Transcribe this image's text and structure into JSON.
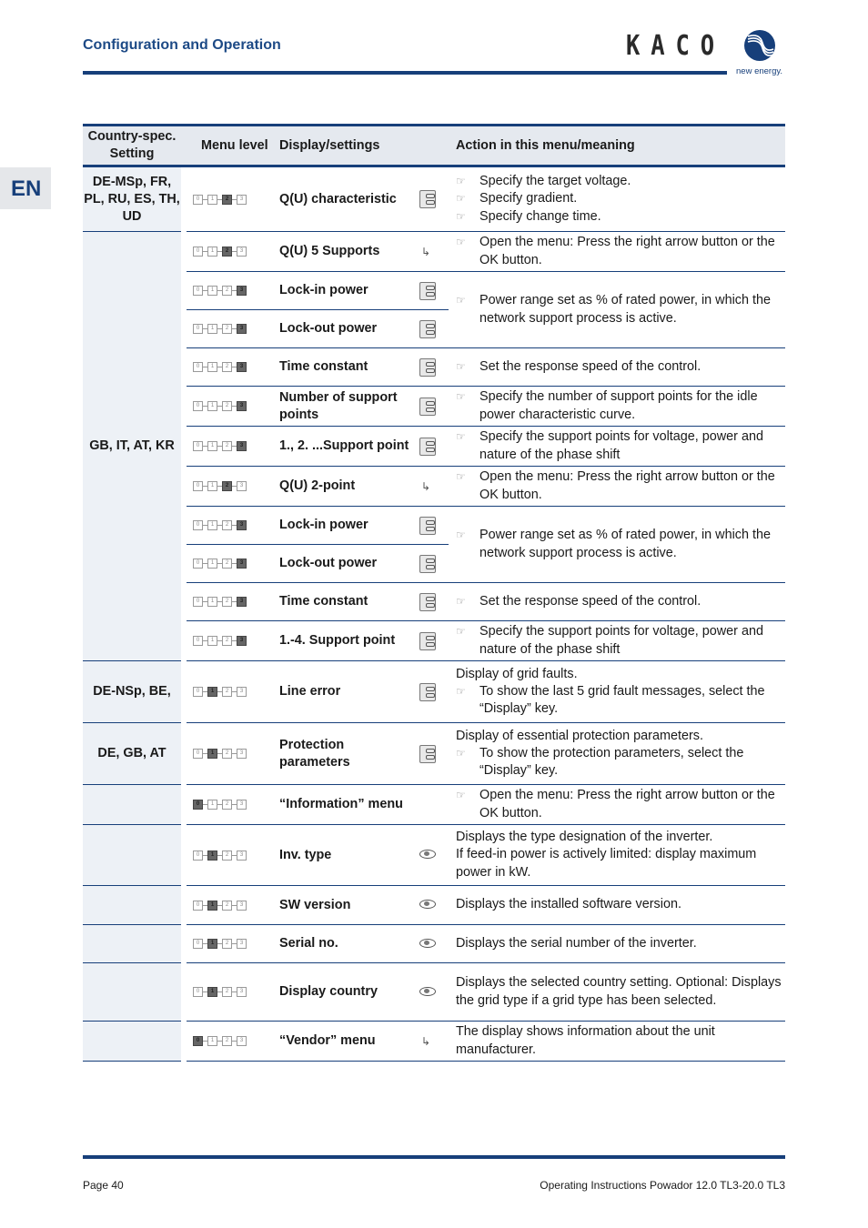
{
  "header": {
    "title": "Configuration and Operation",
    "logo_text": "KACO",
    "logo_tagline": "new energy."
  },
  "language_tab": "EN",
  "table": {
    "headers": [
      "Country-spec. Setting",
      "Menu level",
      "Display/settings",
      "Action in this menu/meaning"
    ],
    "rows": [
      {
        "country": "DE-MSp, FR, PL, RU, ES, TH, UD",
        "level": 2,
        "label": "Q(U) characteristic",
        "icon": "settings-icon",
        "action": {
          "text": "",
          "bullets": [
            "Specify the target voltage.",
            "Specify gradient.",
            "Specify change time."
          ]
        }
      },
      {
        "country": "GB, IT, AT, KR",
        "level": 2,
        "label": "Q(U) 5 Supports",
        "icon": "submenu-arrow-icon",
        "action": {
          "text": "",
          "bullets": [
            "Open the menu: Press the right arrow button or the OK button."
          ]
        }
      },
      {
        "level": 3,
        "label": "Lock-in power",
        "icon": "settings-icon",
        "action": {
          "text": "",
          "bullets": [
            "Power range set as % of rated power, in which the network support process is active."
          ]
        }
      },
      {
        "level": 3,
        "label": "Lock-out power",
        "icon": "settings-icon"
      },
      {
        "level": 3,
        "label": "Time constant",
        "icon": "settings-icon",
        "action": {
          "text": "",
          "bullets": [
            "Set the response speed of the control."
          ]
        }
      },
      {
        "level": 3,
        "label": "Number of support points",
        "icon": "settings-icon",
        "action": {
          "text": "",
          "bullets": [
            "Specify the number of support points for the idle power characteristic curve."
          ]
        }
      },
      {
        "level": 3,
        "label": "1., 2. ...Support point",
        "icon": "settings-icon",
        "action": {
          "text": "",
          "bullets": [
            "Specify the support points for voltage, power and nature of the phase shift"
          ]
        }
      },
      {
        "level": 2,
        "label": "Q(U) 2-point",
        "icon": "submenu-arrow-icon",
        "action": {
          "text": "",
          "bullets": [
            "Open the menu: Press the right arrow button or the OK button."
          ]
        }
      },
      {
        "level": 3,
        "label": "Lock-in power",
        "icon": "settings-icon",
        "action": {
          "text": "",
          "bullets": [
            "Power range set as % of rated power, in which the network support process is active."
          ]
        }
      },
      {
        "level": 3,
        "label": "Lock-out power",
        "icon": "settings-icon"
      },
      {
        "level": 3,
        "label": "Time constant",
        "icon": "settings-icon",
        "action": {
          "text": "",
          "bullets": [
            "Set the response speed of the control."
          ]
        }
      },
      {
        "level": 3,
        "label": "1.-4. Support point",
        "icon": "settings-icon",
        "action": {
          "text": "",
          "bullets": [
            "Specify the support points for voltage, power and nature of the phase shift"
          ]
        }
      },
      {
        "country": "DE-NSp, BE,",
        "level": 1,
        "label": "Line error",
        "icon": "settings-icon",
        "action": {
          "text": "Display of grid faults.",
          "bullets": [
            "To show the last 5 grid fault messages, select the “Display” key."
          ]
        }
      },
      {
        "country": "DE, GB, AT",
        "level": 1,
        "label": "Protection parameters",
        "icon": "settings-icon",
        "action": {
          "text": "Display of essential protection parameters.",
          "bullets": [
            "To show the protection parameters, select the “Display” key."
          ]
        }
      },
      {
        "country": "",
        "level": 0,
        "label": "“Information” menu",
        "icon": "",
        "action": {
          "text": "",
          "bullets": [
            "Open the menu: Press the right arrow button or the OK button."
          ]
        }
      },
      {
        "country": "",
        "level": 1,
        "label": "Inv. type",
        "icon": "eye-icon",
        "action": {
          "text": "Displays the type designation of the inverter.",
          "text2": "If feed-in power is actively limited: display maximum power in kW.",
          "bullets": []
        }
      },
      {
        "country": "",
        "level": 1,
        "label": "SW version",
        "icon": "eye-icon",
        "action": {
          "text": "Displays the installed software version.",
          "bullets": []
        }
      },
      {
        "country": "",
        "level": 1,
        "label": "Serial no.",
        "icon": "eye-icon",
        "action": {
          "text": "Displays the serial number of the inverter.",
          "bullets": []
        }
      },
      {
        "country": "",
        "level": 1,
        "label": "Display country",
        "icon": "eye-icon",
        "action": {
          "text": "Displays the selected country setting. Optional: Displays the grid type if a grid type has been selected.",
          "bullets": []
        }
      },
      {
        "country": "",
        "level": 0,
        "label": "“Vendor” menu",
        "icon": "submenu-arrow-icon",
        "action": {
          "text": "The display shows information about the unit manufacturer.",
          "bullets": []
        }
      }
    ]
  },
  "footer": {
    "page": "Page 40",
    "doc_title": "Operating Instructions Powador 12.0 TL3-20.0 TL3"
  }
}
